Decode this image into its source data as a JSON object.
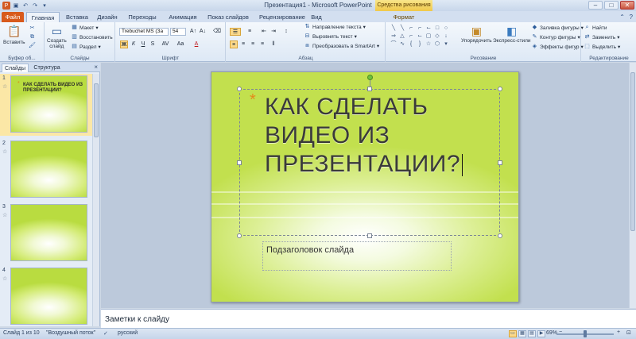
{
  "window": {
    "title": "Презентация1 - Microsoft PowerPoint",
    "context_tab_header": "Средства рисования",
    "controls": [
      "–",
      "□",
      "✕"
    ]
  },
  "tabs": [
    "Файл",
    "Главная",
    "Вставка",
    "Дизайн",
    "Переходы",
    "Анимация",
    "Показ слайдов",
    "Рецензирование",
    "Вид",
    "Формат"
  ],
  "active_tab": "Главная",
  "ribbon": {
    "clipboard": {
      "paste": "Вставить",
      "group": "Буфер об..."
    },
    "slides": {
      "create": "Создать",
      "create2": "слайд",
      "layout": "Макет",
      "reset": "Восстановить",
      "section": "Раздел",
      "group": "Слайды"
    },
    "font": {
      "family": "Trebuchet MS (За",
      "size": "54",
      "group": "Шрифт",
      "bold": "Ж",
      "italic": "К",
      "underline": "Ч",
      "strike": "S",
      "spacing": "AV",
      "case": "Aa",
      "color": "A"
    },
    "paragraph": {
      "direction": "Направление текста",
      "align": "Выровнять текст",
      "smartart": "Преобразовать в SmartArt",
      "group": "Абзац"
    },
    "drawing": {
      "arrange": "Упорядочить",
      "styles": "Экспресс-стили",
      "fill": "Заливка фигуры",
      "outline": "Контур фигуры",
      "effects": "Эффекты фигур",
      "group": "Рисование"
    },
    "editing": {
      "find": "Найти",
      "replace": "Заменить",
      "select": "Выделить",
      "group": "Редактирование"
    }
  },
  "panel": {
    "tabs": [
      "Слайды",
      "Структура"
    ],
    "close": "×",
    "thumbnails": [
      {
        "num": "1",
        "text": "КАК СДЕЛАТЬ ВИДЕО ИЗ ПРЕЗЕНТАЦИИ?"
      },
      {
        "num": "2",
        "text": ""
      },
      {
        "num": "3",
        "text": ""
      },
      {
        "num": "4",
        "text": ""
      }
    ]
  },
  "slide": {
    "title": "Как сделать видео из презентации?",
    "subtitle": "Подзаголовок слайда"
  },
  "notes": "Заметки к слайду",
  "status": {
    "slide": "Слайд 1 из 10",
    "theme": "\"Воздушный поток\"",
    "language": "русский",
    "zoom": "69%"
  },
  "colors": {
    "file_tab": "#d85a1c",
    "slide_green": "#c2e04e",
    "accent_star": "#e48a1c"
  }
}
